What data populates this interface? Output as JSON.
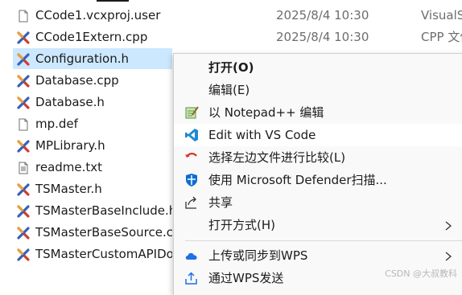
{
  "files": [
    {
      "name": "CCode1.vcxproj.user",
      "date": "2025/8/4 10:30",
      "type": "VisualS",
      "icon": "file-icon"
    },
    {
      "name": "CCode1Extern.cpp",
      "date": "2025/8/4 10:30",
      "type": "CPP 文件",
      "icon": "cpp-file-icon"
    },
    {
      "name": "Configuration.h",
      "date": "",
      "type": "",
      "icon": "cpp-file-icon",
      "selected": true
    },
    {
      "name": "Database.cpp",
      "date": "",
      "type": "",
      "icon": "cpp-file-icon"
    },
    {
      "name": "Database.h",
      "date": "",
      "type": "",
      "icon": "cpp-file-icon"
    },
    {
      "name": "mp.def",
      "date": "",
      "type": "",
      "icon": "file-icon"
    },
    {
      "name": "MPLibrary.h",
      "date": "",
      "type": "",
      "icon": "cpp-file-icon"
    },
    {
      "name": "readme.txt",
      "date": "",
      "type": "",
      "icon": "text-file-icon"
    },
    {
      "name": "TSMaster.h",
      "date": "",
      "type": "",
      "icon": "cpp-file-icon"
    },
    {
      "name": "TSMasterBaseInclude.h",
      "date": "",
      "type": "",
      "icon": "cpp-file-icon"
    },
    {
      "name": "TSMasterBaseSource.cpp",
      "date": "",
      "type": "",
      "icon": "cpp-file-icon"
    },
    {
      "name": "TSMasterCustomAPIDo",
      "date": "",
      "type": "",
      "icon": "cpp-file-icon"
    }
  ],
  "context_menu": {
    "items": [
      {
        "label": "打开(O)",
        "bold": true,
        "icon": ""
      },
      {
        "label": "编辑(E)",
        "icon": ""
      },
      {
        "label": "以 Notepad++ 编辑",
        "icon": "notepadpp-icon"
      },
      {
        "label": "Edit with VS Code",
        "icon": "vscode-icon",
        "hover": true
      },
      {
        "label": "选择左边文件进行比较(L)",
        "icon": "compare-icon"
      },
      {
        "label": "使用 Microsoft Defender扫描...",
        "icon": "defender-shield-icon"
      },
      {
        "label": "共享",
        "icon": "share-icon"
      },
      {
        "label": "打开方式(H)",
        "icon": "",
        "submenu": true
      },
      {
        "label": "上传或同步到WPS",
        "icon": "wps-cloud-icon",
        "submenu": true
      },
      {
        "label": "通过WPS发送",
        "icon": "wps-send-icon"
      }
    ]
  },
  "watermark": "CSDN @大叔教科",
  "colors": {
    "selection": "#cce8ff",
    "menu_bg": "#f9f9f9",
    "vscode_blue": "#1f8ad2",
    "defender_blue": "#0a6ed1",
    "cpp_icon_red": "#d33b2c",
    "cpp_icon_blue": "#3b5fb5"
  }
}
